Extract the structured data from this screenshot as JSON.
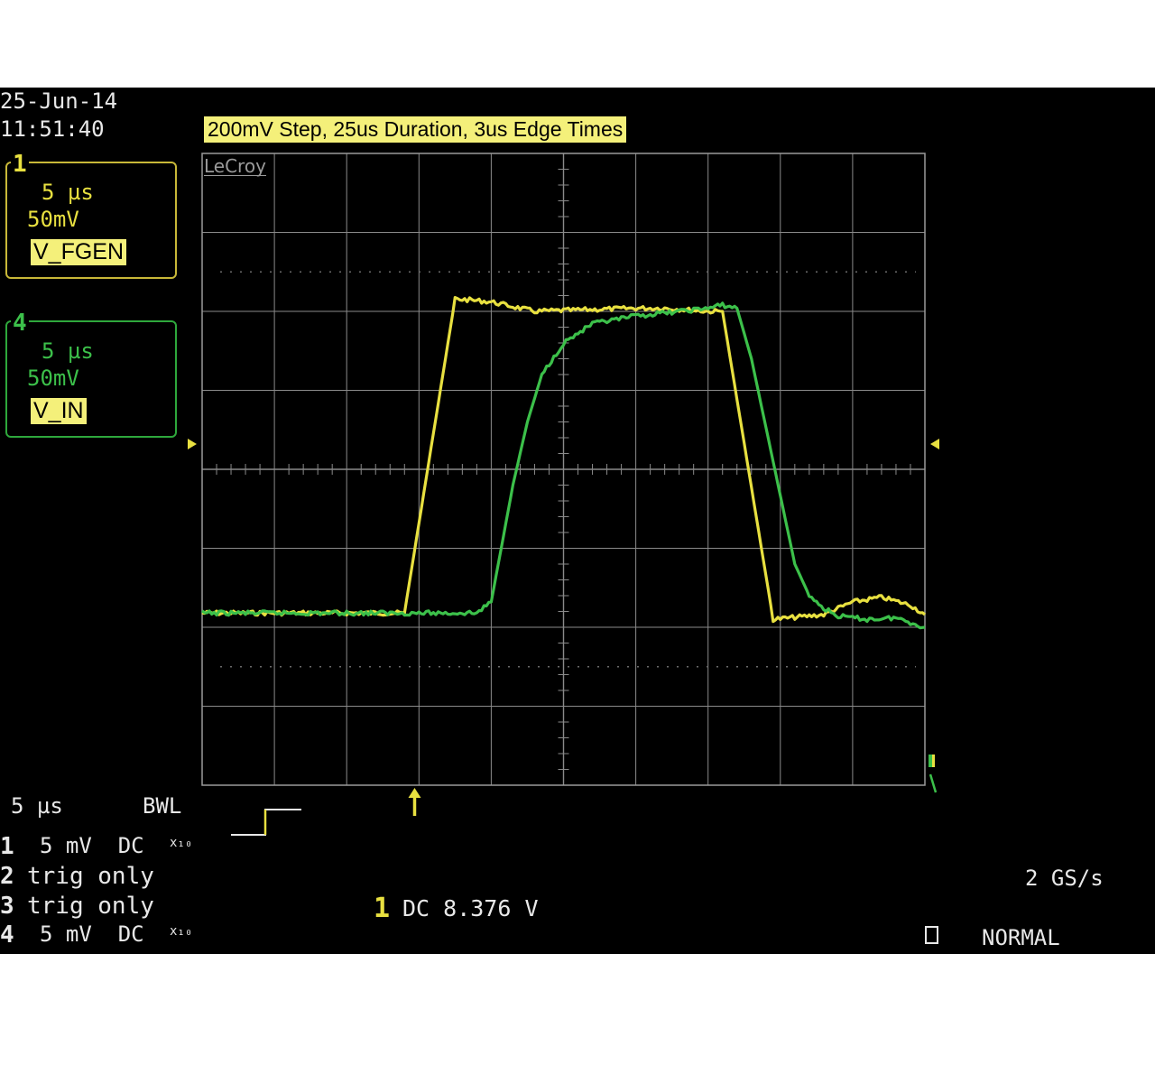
{
  "header": {
    "date": "25-Jun-14",
    "time": "11:51:40",
    "annotation": "200mV Step, 25us Duration, 3us Edge Times",
    "brand": "LeCroy"
  },
  "channels": [
    {
      "num": "1",
      "timebase": "5 µs",
      "volts_div": "50mV",
      "label": "V_FGEN",
      "color": "#e8e040"
    },
    {
      "num": "4",
      "timebase": "5 µs",
      "volts_div": "50mV",
      "label": "V_IN",
      "color": "#3cc04a"
    }
  ],
  "status": {
    "timebase": "5 µs",
    "bwl": "BWL",
    "rows": [
      {
        "num": "1",
        "text": "5 mV  DC"
      },
      {
        "num": "2",
        "text": "trig only"
      },
      {
        "num": "3",
        "text": "trig only"
      },
      {
        "num": "4",
        "text": "5 mV  DC"
      }
    ],
    "x10": "x₁₀",
    "trigger_channel": "1",
    "trigger_level": "DC 8.376 V",
    "sample_rate": "2 GS/s",
    "trigger_mode": "NORMAL"
  },
  "colors": {
    "background": "#000000",
    "grid": "#8a8a8a",
    "channel1": "#e8e040",
    "channel4": "#3cc04a",
    "chip": "#f4f07a"
  },
  "chart_data": {
    "type": "line",
    "xlabel": "",
    "ylabel": "",
    "xlim": [
      0,
      50
    ],
    "ylim": [
      -200,
      200
    ],
    "x_units": "µs",
    "y_units": "mV",
    "grid": true,
    "series": [
      {
        "name": "V_FGEN",
        "color": "#e8e040",
        "points": [
          [
            0,
            -91
          ],
          [
            14,
            -91
          ],
          [
            17.5,
            108
          ],
          [
            20,
            106
          ],
          [
            23,
            100
          ],
          [
            30,
            102
          ],
          [
            32,
            102
          ],
          [
            35,
            100
          ],
          [
            36,
            100
          ],
          [
            39.5,
            -95
          ],
          [
            43,
            -92
          ],
          [
            45,
            -84
          ],
          [
            47,
            -81
          ],
          [
            49,
            -86
          ],
          [
            50,
            -92
          ]
        ]
      },
      {
        "name": "V_IN",
        "color": "#3cc04a",
        "points": [
          [
            0,
            -91
          ],
          [
            19,
            -91
          ],
          [
            20,
            -84
          ],
          [
            21.5,
            -10
          ],
          [
            22.5,
            30
          ],
          [
            23.5,
            60
          ],
          [
            25,
            80
          ],
          [
            27,
            92
          ],
          [
            30,
            97
          ],
          [
            35,
            102
          ],
          [
            36,
            104
          ],
          [
            37,
            102
          ],
          [
            38,
            70
          ],
          [
            39.5,
            5
          ],
          [
            41,
            -60
          ],
          [
            42,
            -80
          ],
          [
            43,
            -88
          ],
          [
            44,
            -93
          ],
          [
            46,
            -95
          ],
          [
            48,
            -94
          ],
          [
            50,
            -100
          ]
        ]
      }
    ]
  }
}
